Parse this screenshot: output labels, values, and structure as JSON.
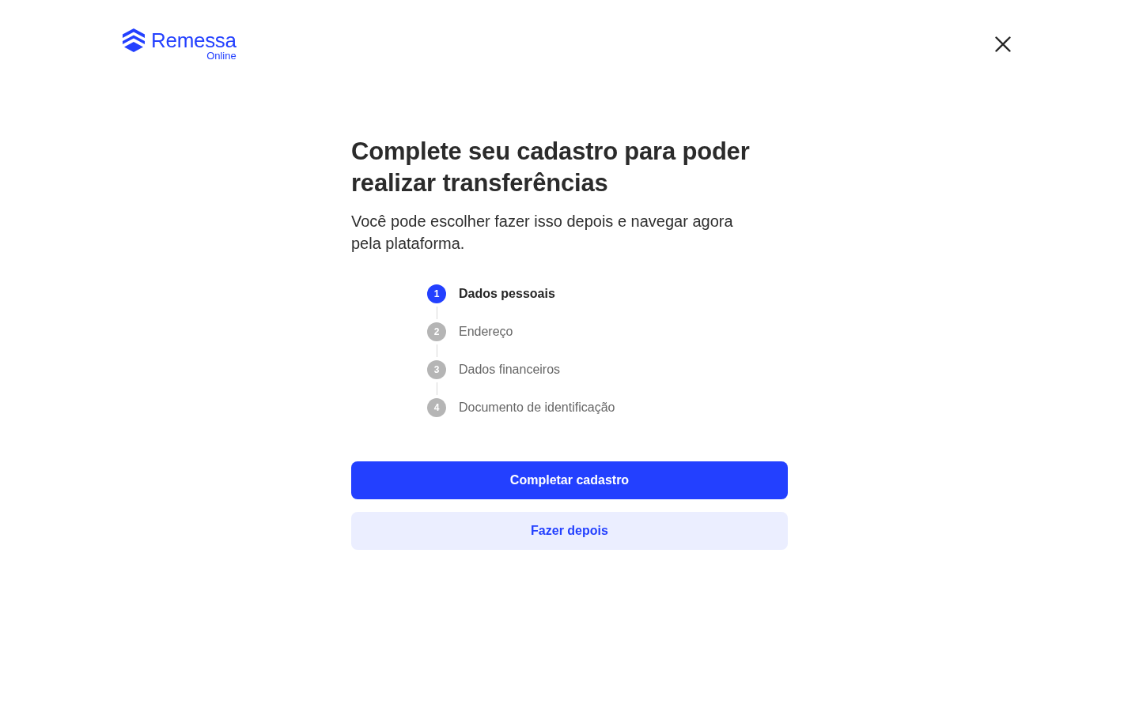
{
  "header": {
    "logo": {
      "wordmark": "Remessa",
      "tagline": "Online"
    }
  },
  "title": "Complete seu cadastro para poder realizar transferências",
  "subtitle": "Você pode escolher fazer isso depois e navegar agora pela plataforma.",
  "steps": [
    {
      "number": "1",
      "label": "Dados pessoais",
      "selected": true
    },
    {
      "number": "2",
      "label": "Endereço",
      "selected": false
    },
    {
      "number": "3",
      "label": "Dados financeiros",
      "selected": false
    },
    {
      "number": "4",
      "label": "Documento de identificação",
      "selected": false
    }
  ],
  "buttons": [
    {
      "label": "Completar cadastro",
      "kind": "primary"
    },
    {
      "label": "Fazer depois",
      "kind": "secondary"
    }
  ]
}
